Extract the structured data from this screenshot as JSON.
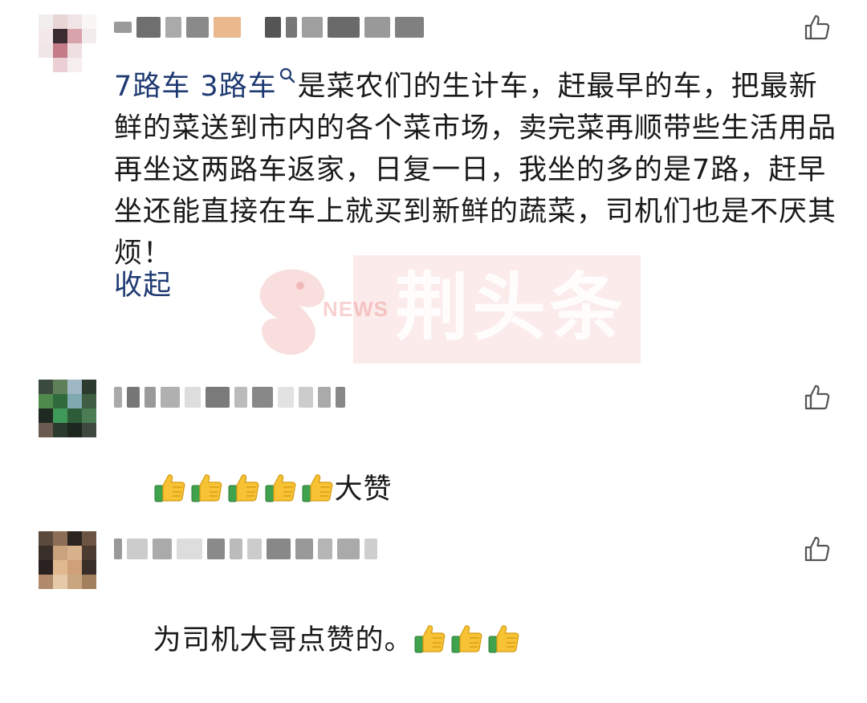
{
  "comments": [
    {
      "topic": "7路车 3路车",
      "text": "是菜农们的生计车，赶最早的车，把最新鲜的菜送到市内的各个菜市场，卖完菜再顺带些生活用品再坐这两路车返家，日复一日，我坐的多的是7路，赶早坐还能直接在车上就买到新鲜的蔬菜，司机们也是不厌其烦！",
      "collapse_label": "收起",
      "like_icon": "thumbs-up-outline-icon"
    },
    {
      "text": "大赞",
      "emoji": "thumbs-up-emoji",
      "emoji_count": 5,
      "like_icon": "thumbs-up-outline-icon"
    },
    {
      "text": "为司机大哥点赞的。",
      "emoji": "thumbs-up-emoji",
      "emoji_count": 3,
      "like_icon": "thumbs-up-outline-icon"
    }
  ],
  "watermark": {
    "label": "荆头条",
    "news": "NEWS",
    "color": "#d83c3c"
  },
  "colors": {
    "link": "#1f3a72",
    "text": "#1a1a1a",
    "icon": "#555555"
  }
}
